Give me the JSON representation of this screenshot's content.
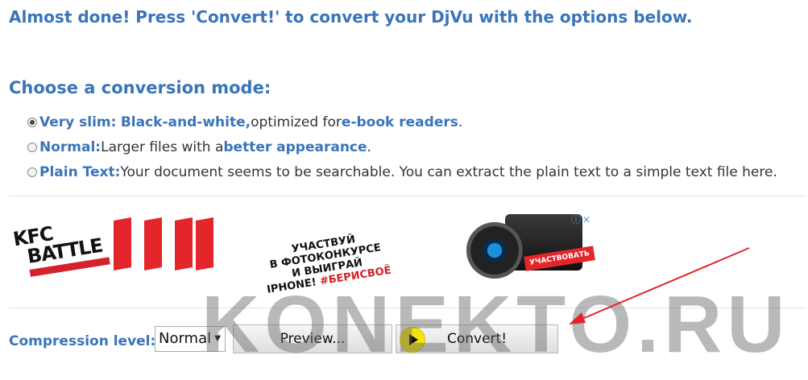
{
  "header": {
    "title": "Almost done! Press 'Convert!' to convert your DjVu with the options below."
  },
  "modes_section": {
    "heading": "Choose a conversion mode:",
    "options": [
      {
        "selected": true,
        "label": "Very slim:",
        "link1": "Black-and-white,",
        "text1": " optimized for ",
        "link2": "e-book readers",
        "text2": "."
      },
      {
        "selected": false,
        "label": "Normal:",
        "text1": " Larger files with a ",
        "link1": "better appearance",
        "text2": "."
      },
      {
        "selected": false,
        "label": "Plain Text:",
        "text1": " Your document seems to be searchable. You can extract the plain text to a simple text file here."
      }
    ]
  },
  "ad": {
    "brand_line1": "KFC",
    "brand_line2": "BATTLE",
    "promo_text": "УЧАСТВУЙ\nВ ФОТОКОНКУРСЕ\nИ ВЫИГРАЙ\nIPHONE!",
    "promo_tag": "#БЕРИСВОЁ",
    "cta": "УЧАСТВОВАТЬ",
    "info_icon": "info-icon",
    "close_icon": "close-icon",
    "colors": {
      "red": "#e3262c"
    }
  },
  "controls": {
    "compression_label": "Compression level:",
    "compression_value": "Normal",
    "preview_label": "Preview...",
    "convert_label": "Convert!"
  },
  "watermark": "KONEKTO.RU",
  "colors": {
    "heading": "#3a74b9",
    "annotation_arrow": "#e3262c"
  }
}
